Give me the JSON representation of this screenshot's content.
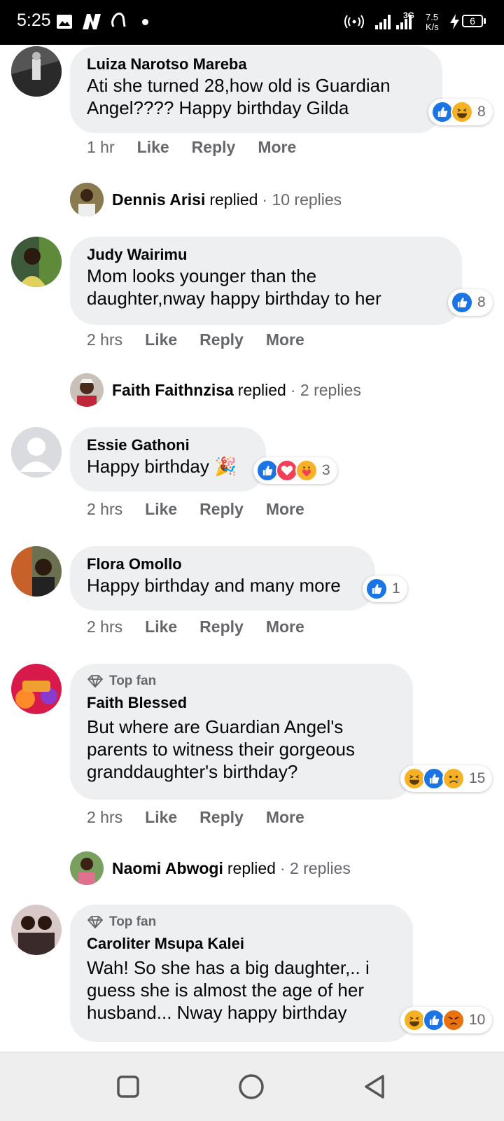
{
  "status_bar": {
    "time": "5:25",
    "net_label": "3G",
    "speed_value": "7.5",
    "speed_unit": "K/s",
    "battery": "6"
  },
  "comments": [
    {
      "author": "Luiza Narotso Mareba",
      "text_lines": [
        "Ati she turned 28,how old is Guardian",
        "Angel???? Happy birthday Gilda"
      ],
      "time": "1 hr",
      "reactions": [
        "like",
        "haha"
      ],
      "reaction_count": "8",
      "replied": {
        "name": "Dennis Arisi",
        "word": "replied",
        "count": "· 10 replies"
      }
    },
    {
      "author": "Judy Wairimu",
      "text_lines": [
        "Mom looks younger than the",
        "daughter,nway happy birthday to her"
      ],
      "time": "2 hrs",
      "reactions": [
        "like"
      ],
      "reaction_count": "8",
      "replied": {
        "name": "Faith Faithnzisa",
        "word": "replied",
        "count": "· 2 replies"
      }
    },
    {
      "author": "Essie Gathoni",
      "text_lines": [
        "Happy birthday 🎉"
      ],
      "time": "2 hrs",
      "reactions": [
        "like",
        "love",
        "care"
      ],
      "reaction_count": "3"
    },
    {
      "author": "Flora Omollo",
      "text_lines": [
        "Happy birthday and many more"
      ],
      "time": "2 hrs",
      "reactions": [
        "like"
      ],
      "reaction_count": "1"
    },
    {
      "badge": "Top fan",
      "author": "Faith Blessed",
      "text_lines": [
        "But where are Guardian Angel's",
        "parents to witness their gorgeous",
        "granddaughter's birthday?"
      ],
      "time": "2 hrs",
      "reactions": [
        "haha",
        "like",
        "sad"
      ],
      "reaction_count": "15",
      "replied": {
        "name": "Naomi Abwogi",
        "word": "replied",
        "count": "· 2 replies"
      }
    },
    {
      "badge": "Top fan",
      "author": "Caroliter Msupa Kalei",
      "text_lines": [
        "Wah! So she has a big daughter,.. i",
        "guess she is almost the age of her",
        "husband... Nway happy birthday"
      ],
      "reactions": [
        "haha",
        "like",
        "angry"
      ],
      "reaction_count": "10"
    }
  ],
  "actions": {
    "like": "Like",
    "reply": "Reply",
    "more": "More"
  },
  "nav": {
    "recent_icon": "square-icon",
    "home_icon": "circle-icon",
    "back_icon": "triangle-back-icon"
  },
  "colors": {
    "bubble": "#eeeff1",
    "like_blue": "#1b74e4",
    "muted": "#65676b"
  }
}
